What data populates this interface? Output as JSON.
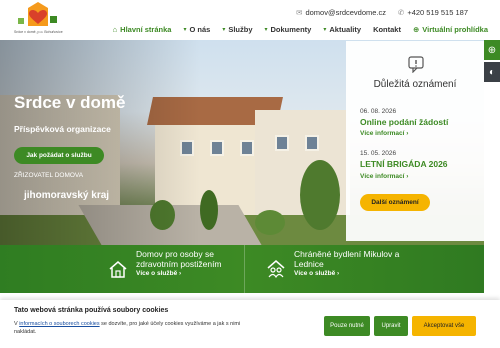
{
  "logo": {
    "caption": "Srdce v domě, p.o. Bohuňovice"
  },
  "contact": {
    "email": "domov@srdcevdome.cz",
    "phone": "+420 519 515 187"
  },
  "nav": {
    "items": [
      {
        "label": "Hlavní stránka",
        "icon": "home-icon",
        "active": true
      },
      {
        "label": "O nás",
        "dropdown": true
      },
      {
        "label": "Služby",
        "dropdown": true
      },
      {
        "label": "Dokumenty",
        "dropdown": true
      },
      {
        "label": "Aktuality",
        "dropdown": true
      },
      {
        "label": "Kontakt"
      },
      {
        "label": "Virtuální prohlídka",
        "icon": "tour-icon"
      }
    ]
  },
  "hero": {
    "title": "Srdce v domě",
    "subtitle": "Příspěvková organizace",
    "button": "Jak požádat o službu",
    "founder_label": "ZŘIZOVATEL DOMOVA",
    "founder": "jihomoravský kraj"
  },
  "announcements": {
    "title": "Důležitá oznámení",
    "items": [
      {
        "date": "06. 08. 2026",
        "headline": "Online podání žádostí",
        "more": "Více informací ›"
      },
      {
        "date": "15. 05. 2026",
        "headline": "LETNÍ BRIGÁDA 2026",
        "more": "Více informací ›"
      }
    ],
    "button": "Další oznámení"
  },
  "services": [
    {
      "title": "Domov pro osoby se zdravotním postižením",
      "more": "Více o službě ›",
      "icon": "house-icon"
    },
    {
      "title": "Chráněné bydlení Mikulov a Lednice",
      "more": "Více o službě ›",
      "icon": "people-house-icon"
    }
  ],
  "cookie": {
    "title": "Tato webová stránka používá soubory cookies",
    "text_prefix": "V ",
    "link": "informacích o souborech cookies",
    "text_suffix": " se dozvíte, pro jaké účely cookies využíváme a jak s nimi nakládat.",
    "settings": "Pouze nutné",
    "adjust": "Upravit",
    "accept": "Akceptovat vše"
  },
  "colors": {
    "brand_green": "#3d8a24",
    "accent_yellow": "#f5b400",
    "dark": "#3b4046"
  }
}
